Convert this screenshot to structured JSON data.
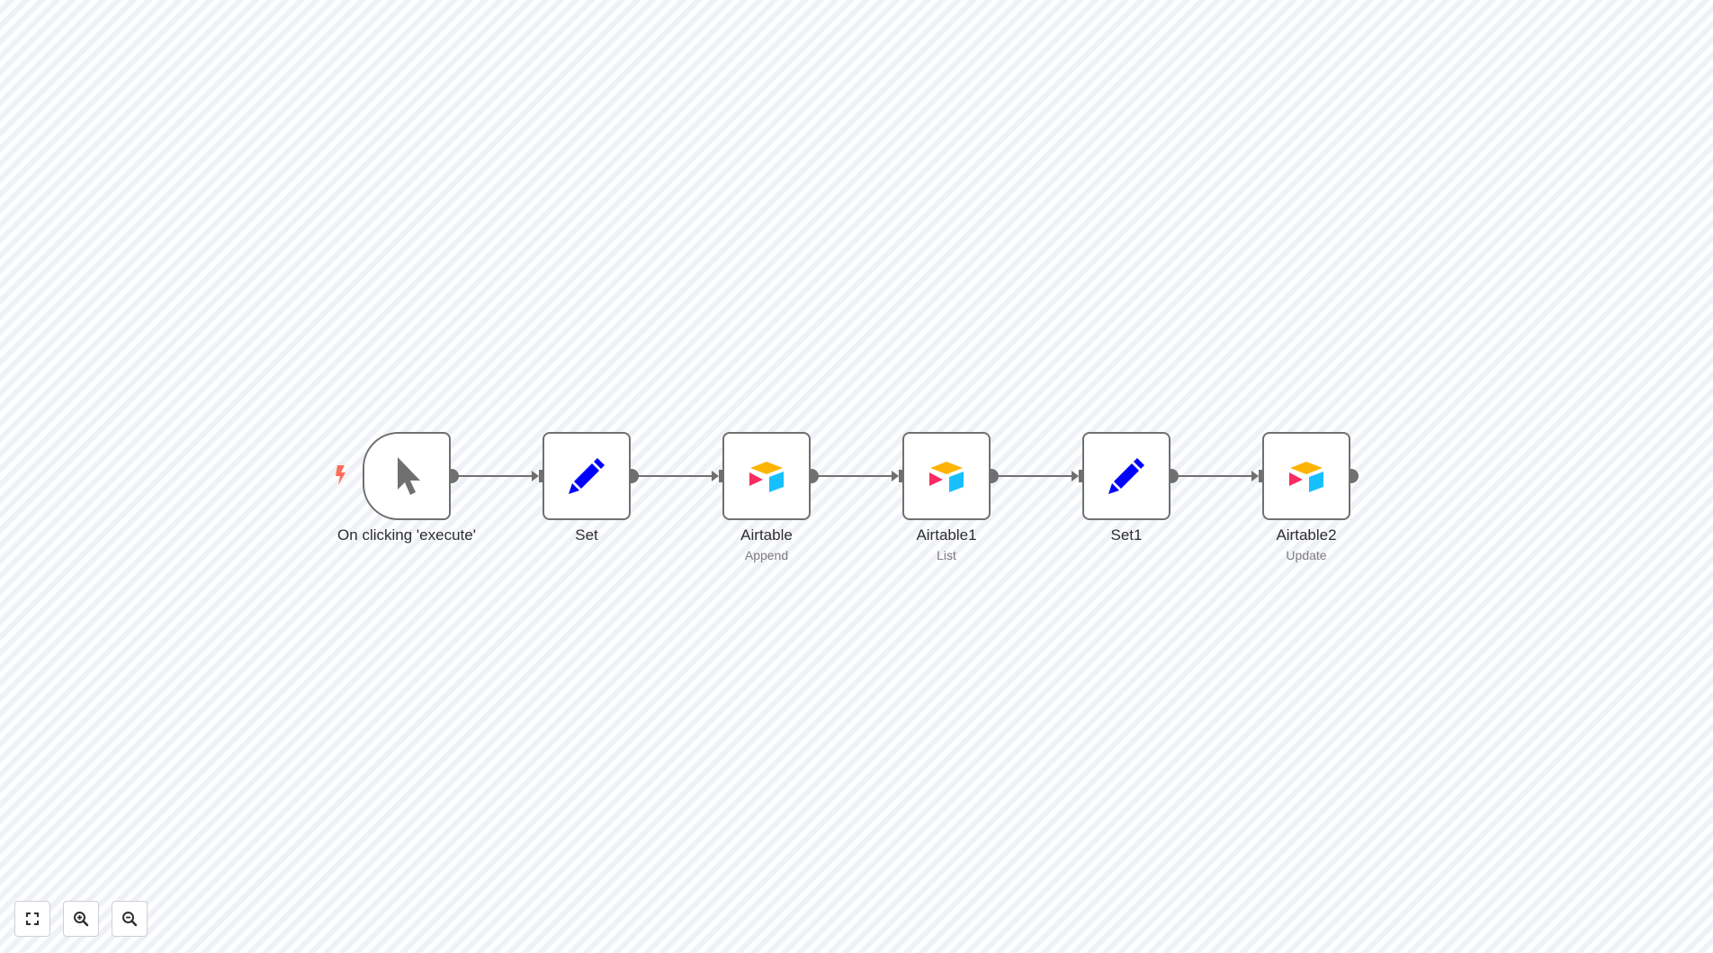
{
  "workflow": {
    "nodes": [
      {
        "id": "trigger",
        "label": "On clicking 'execute'",
        "subtitle": "",
        "icon": "cursor-icon",
        "kind": "trigger"
      },
      {
        "id": "set",
        "label": "Set",
        "subtitle": "",
        "icon": "pencil-icon",
        "kind": "action"
      },
      {
        "id": "airtable",
        "label": "Airtable",
        "subtitle": "Append",
        "icon": "airtable-icon",
        "kind": "action"
      },
      {
        "id": "airtable1",
        "label": "Airtable1",
        "subtitle": "List",
        "icon": "airtable-icon",
        "kind": "action"
      },
      {
        "id": "set1",
        "label": "Set1",
        "subtitle": "",
        "icon": "pencil-icon",
        "kind": "action"
      },
      {
        "id": "airtable2",
        "label": "Airtable2",
        "subtitle": "Update",
        "icon": "airtable-icon",
        "kind": "action"
      }
    ]
  },
  "controls": {
    "buttons": [
      {
        "name": "fit-view-button",
        "icon": "fullscreen-icon"
      },
      {
        "name": "zoom-in-button",
        "icon": "zoom-in-icon"
      },
      {
        "name": "zoom-out-button",
        "icon": "zoom-out-icon"
      }
    ]
  },
  "colors": {
    "node_border": "#707070",
    "edge": "#707070",
    "trigger_bolt": "#ff6d5a",
    "set_pencil": "#0000ff",
    "airtable_yellow": "#fcb400",
    "airtable_red": "#f82b60",
    "airtable_blue": "#18bfff",
    "cursor": "#707070"
  }
}
